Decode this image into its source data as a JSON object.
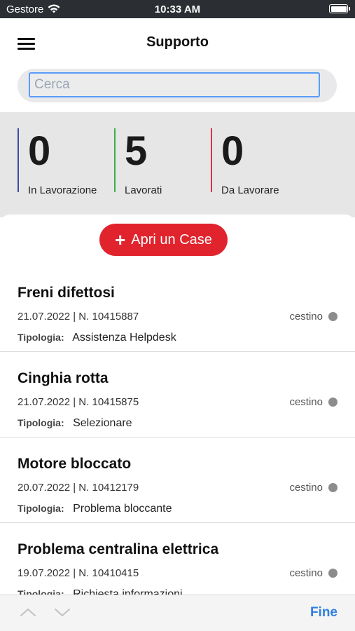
{
  "status_bar": {
    "carrier": "Gestore",
    "time": "10:33 AM"
  },
  "nav": {
    "title": "Supporto"
  },
  "search": {
    "placeholder": "Cerca",
    "value": ""
  },
  "stats": [
    {
      "value": "0",
      "label": "In Lavorazione",
      "color": "#3b4ea8"
    },
    {
      "value": "5",
      "label": "Lavorati",
      "color": "#3fae49"
    },
    {
      "value": "0",
      "label": "Da Lavorare",
      "color": "#d9363e"
    }
  ],
  "open_case": {
    "label": "Apri un Case",
    "icon": "plus-icon"
  },
  "cases": [
    {
      "title": "Freni difettosi",
      "meta": "21.07.2022 | N. 10415887",
      "status": "cestino",
      "type_label": "Tipologia:",
      "type_value": "Assistenza Helpdesk"
    },
    {
      "title": "Cinghia rotta",
      "meta": "21.07.2022 | N. 10415875",
      "status": "cestino",
      "type_label": "Tipologia:",
      "type_value": "Selezionare"
    },
    {
      "title": "Motore bloccato",
      "meta": "20.07.2022 | N. 10412179",
      "status": "cestino",
      "type_label": "Tipologia:",
      "type_value": "Problema bloccante"
    },
    {
      "title": "Problema centralina elettrica",
      "meta": "19.07.2022 | N. 10410415",
      "status": "cestino",
      "type_label": "Tipologia:",
      "type_value": "Richiesta informazioni"
    }
  ],
  "bottom_bar": {
    "done_label": "Fine"
  },
  "colors": {
    "accent_red": "#e0232c",
    "link_blue": "#2f7fe0"
  }
}
